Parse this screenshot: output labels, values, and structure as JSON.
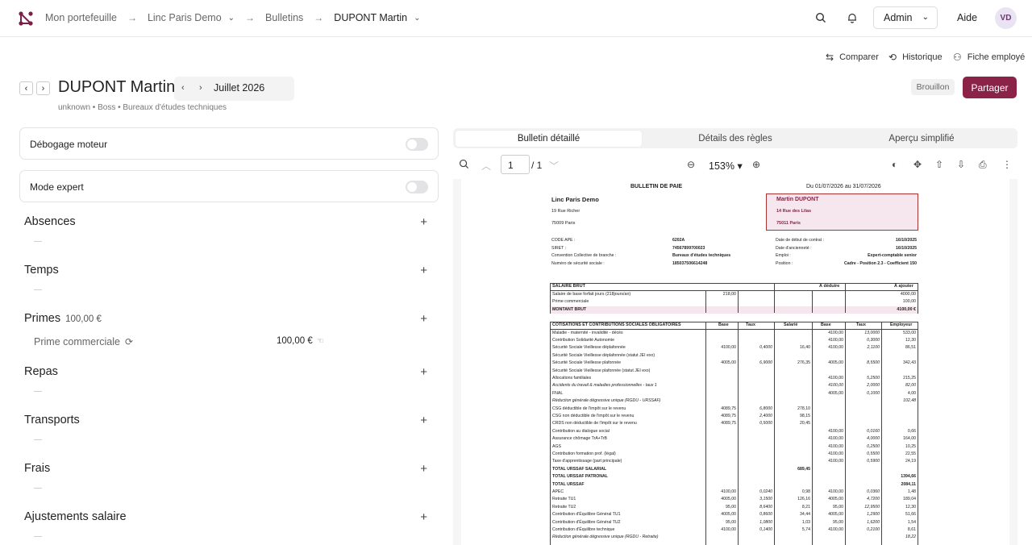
{
  "breadcrumb": {
    "portfolio": "Mon portefeuille",
    "company": "Linc Paris Demo",
    "section": "Bulletins",
    "employee": "DUPONT Martin"
  },
  "topbar": {
    "admin_label": "Admin",
    "help_label": "Aide",
    "avatar_initials": "VD"
  },
  "actions": {
    "compare": "Comparer",
    "history": "Historique",
    "employee_sheet": "Fiche employé"
  },
  "header": {
    "employee_name": "DUPONT Martin",
    "month": "Juillet 2026",
    "subtitle": "unknown • Boss • Bureaux d'études techniques",
    "status_badge": "Brouillon",
    "share_label": "Partager"
  },
  "toggles": [
    {
      "label": "Débogage moteur",
      "on": false
    },
    {
      "label": "Mode expert",
      "on": false
    }
  ],
  "sections": [
    {
      "title": "Absences",
      "amount": "",
      "empty": "—"
    },
    {
      "title": "Temps",
      "amount": "",
      "empty": "—"
    },
    {
      "title": "Primes",
      "amount": "100,00 €",
      "empty": ""
    },
    {
      "title": "Repas",
      "amount": "",
      "empty": "—"
    },
    {
      "title": "Transports",
      "amount": "",
      "empty": "—"
    },
    {
      "title": "Frais",
      "amount": "",
      "empty": "—"
    },
    {
      "title": "Ajustements salaire",
      "amount": "",
      "empty": "—"
    }
  ],
  "prime_item": {
    "label": "Prime commerciale",
    "value": "100,00 €"
  },
  "tabs": [
    "Bulletin détaillé",
    "Détails des règles",
    "Aperçu simplifié"
  ],
  "viewer": {
    "page": "1",
    "total": "/ 1",
    "zoom": "153%"
  },
  "payslip": {
    "title": "BULLETIN DE PAIE",
    "period": "Du 01/07/2026 au 31/07/2026",
    "company_name": "Linc Paris Demo",
    "company_street": "19 Rue Richer",
    "company_city": "75009 Paris",
    "employee_name": "Martin DUPONT",
    "employee_street": "14 Rue des Lilas",
    "employee_city": "75011 Paris",
    "info_left": [
      [
        "CODE APE :",
        "6202A"
      ],
      [
        "SIRET :",
        "74567899700023"
      ],
      [
        "Convention Collective de branche :",
        "Bureaux d'études techniques"
      ],
      [
        "Numéro de sécurité sociale :",
        "185037506614248"
      ]
    ],
    "info_right": [
      [
        "Date de début de contrat :",
        "16/10/2025"
      ],
      [
        "Date d'ancienneté :",
        "16/10/2025"
      ],
      [
        "Emploi :",
        "Expert-comptable senior"
      ],
      [
        "Position :",
        "Cadre - Position 2.3 - Coefficient 150"
      ]
    ],
    "brut_header": [
      "SALAIRE BRUT",
      "À déduire",
      "À ajouter"
    ],
    "brut_rows": [
      {
        "label": "Salaire de base forfait jours (218jours/an)",
        "base": "218,00",
        "add": "4000,00"
      },
      {
        "label": "Prime commerciale",
        "base": "",
        "add": "100,00"
      },
      {
        "label": "MONTANT BRUT",
        "base": "",
        "add": "4100,00 €"
      }
    ],
    "cot_header": [
      "COTISATIONS ET CONTRIBUTIONS SOCIALES OBLIGATOIRES",
      "Base",
      "Taux",
      "Salarié",
      "Base",
      "Taux",
      "Employeur"
    ],
    "cot_rows": [
      {
        "l": "Maladie - maternité - invalidité - décès",
        "c": [
          "",
          "",
          "",
          "4100,00",
          "13,0000",
          "533,00"
        ]
      },
      {
        "l": "Contribution Solidarité Autonomie",
        "c": [
          "",
          "",
          "",
          "4100,00",
          "0,3000",
          "12,30"
        ]
      },
      {
        "l": "Sécurité Sociale Vieillesse déplafonnée",
        "c": [
          "4100,00",
          "0,4000",
          "16,40",
          "4100,00",
          "2,1100",
          "86,51"
        ]
      },
      {
        "l": "Sécurité Sociale Vieillesse déplafonnée (statut JEI exo)",
        "c": [
          "",
          "",
          "",
          "",
          "",
          ""
        ]
      },
      {
        "l": "Sécurité Sociale Vieillesse plafonnée",
        "c": [
          "4005,00",
          "6,9000",
          "276,35",
          "4005,00",
          "8,5500",
          "342,43"
        ]
      },
      {
        "l": "Sécurité Sociale Vieillesse plafonnée (statut JEI exo)",
        "c": [
          "",
          "",
          "",
          "",
          "",
          ""
        ]
      },
      {
        "l": "Allocations familiales",
        "c": [
          "",
          "",
          "",
          "4100,00",
          "5,2500",
          "215,25"
        ]
      },
      {
        "l": "Accidents du travail & maladies professionnelles - taux 1",
        "c": [
          "",
          "",
          "",
          "4100,00",
          "2,0000",
          "82,00"
        ]
      },
      {
        "l": "FNAL",
        "c": [
          "",
          "",
          "",
          "4005,00",
          "0,1000",
          "4,00"
        ]
      },
      {
        "l": "Réduction générale dégressive unique (RGDU - URSSAF)",
        "c": [
          "",
          "",
          "",
          "",
          "",
          "102,48"
        ]
      },
      {
        "l": "CSG déductible de l'impôt sur le revenu",
        "c": [
          "4089,75",
          "6,8000",
          "278,10",
          "",
          "",
          ""
        ]
      },
      {
        "l": "CSG non déductible de l'impôt sur le revenu",
        "c": [
          "4089,75",
          "2,4000",
          "98,15",
          "",
          "",
          ""
        ]
      },
      {
        "l": "CRDS non déductible de l'impôt sur le revenu",
        "c": [
          "4089,75",
          "0,5000",
          "20,45",
          "",
          "",
          ""
        ]
      },
      {
        "l": "Contribution au dialogue social",
        "c": [
          "",
          "",
          "",
          "4100,00",
          "0,0160",
          "0,66"
        ]
      },
      {
        "l": "Assurance chômage TrA+TrB",
        "c": [
          "",
          "",
          "",
          "4100,00",
          "4,0000",
          "164,00"
        ]
      },
      {
        "l": "AGS",
        "c": [
          "",
          "",
          "",
          "4100,00",
          "0,2500",
          "10,25"
        ]
      },
      {
        "l": "Contribution formation prof. (légal)",
        "c": [
          "",
          "",
          "",
          "4100,00",
          "0,5500",
          "22,55"
        ]
      },
      {
        "l": "Taxe d'apprentissage (part principale)",
        "c": [
          "",
          "",
          "",
          "4100,00",
          "0,5900",
          "24,19"
        ]
      },
      {
        "l": "TOTAL URSSAF SALARIAL",
        "c": [
          "",
          "",
          "689,45",
          "",
          "",
          ""
        ]
      },
      {
        "l": "TOTAL URSSAF PATRONAL",
        "c": [
          "",
          "",
          "",
          "",
          "",
          "1394,66"
        ]
      },
      {
        "l": "TOTAL URSSAF",
        "c": [
          "",
          "",
          "",
          "",
          "",
          "2084,11"
        ]
      },
      {
        "l": "APEC",
        "c": [
          "4100,00",
          "0,0240",
          "0,98",
          "4100,00",
          "0,0360",
          "1,48"
        ]
      },
      {
        "l": "Retraite TU1",
        "c": [
          "4005,00",
          "3,1500",
          "126,16",
          "4005,00",
          "4,7200",
          "189,04"
        ]
      },
      {
        "l": "Retraite TU2",
        "c": [
          "95,00",
          "8,6400",
          "8,21",
          "95,00",
          "12,9500",
          "12,30"
        ]
      },
      {
        "l": "Contribution d'Équilibre Général TU1",
        "c": [
          "4005,00",
          "0,8600",
          "34,44",
          "4005,00",
          "1,2900",
          "51,66"
        ]
      },
      {
        "l": "Contribution d'Équilibre Général TU2",
        "c": [
          "95,00",
          "1,0800",
          "1,03",
          "95,00",
          "1,6200",
          "1,54"
        ]
      },
      {
        "l": "Contribution d'Équilibre technique",
        "c": [
          "4100,00",
          "0,1400",
          "5,74",
          "4100,00",
          "0,2100",
          "8,61"
        ]
      },
      {
        "l": "Réduction générale dégressive unique (RGDU - Retraite)",
        "c": [
          "",
          "",
          "",
          "",
          "",
          "18,22"
        ]
      }
    ]
  }
}
